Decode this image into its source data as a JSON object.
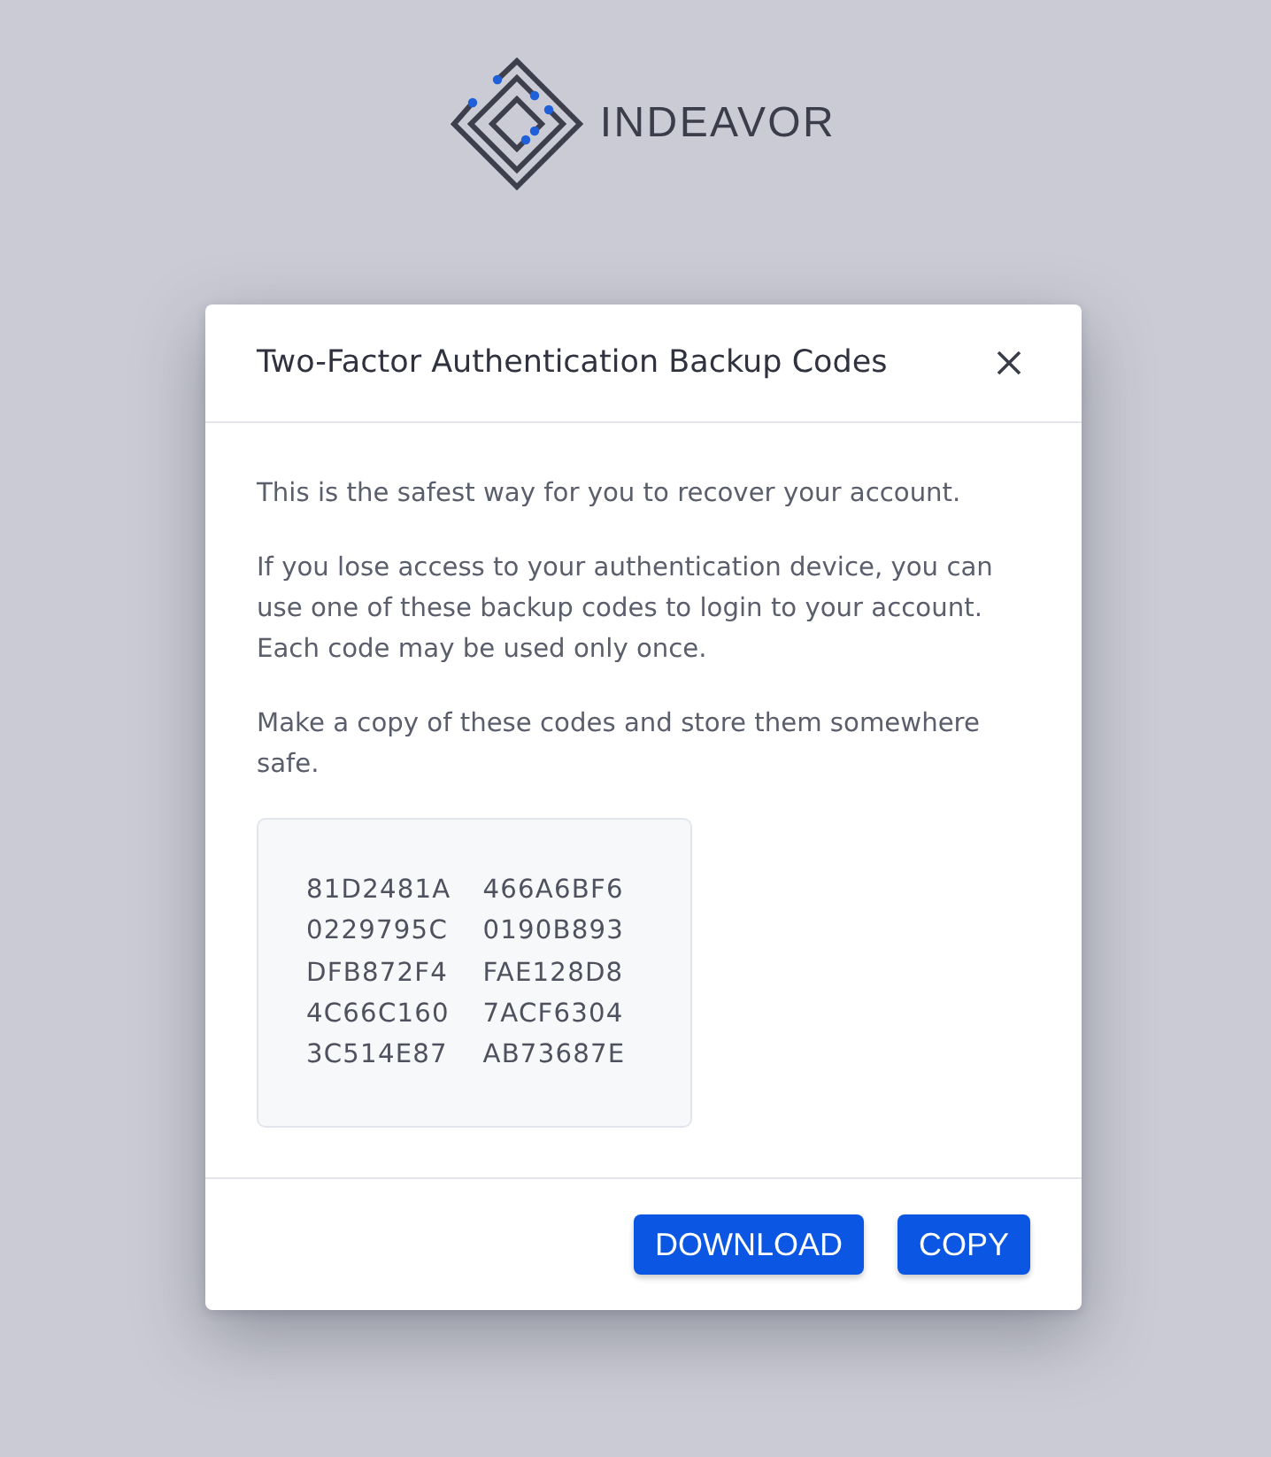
{
  "brand": {
    "name": "INDEAVOR"
  },
  "dialog": {
    "title": "Two-Factor Authentication Backup Codes",
    "paragraphs": [
      "This is the safest way for you to recover your account.",
      "If you lose access to your authentication device, you can use one of these backup codes to login to your account. Each code may be used only once.",
      "Make a copy of these codes and store them somewhere safe."
    ],
    "codes": [
      [
        "81D2481A",
        "466A6BF6"
      ],
      [
        "0229795C",
        "0190B893"
      ],
      [
        "DFB872F4",
        "FAE128D8"
      ],
      [
        "4C66C160",
        "7ACF6304"
      ],
      [
        "3C514E87",
        "AB73687E"
      ]
    ],
    "buttons": [
      "DOWNLOAD",
      "COPY"
    ]
  }
}
